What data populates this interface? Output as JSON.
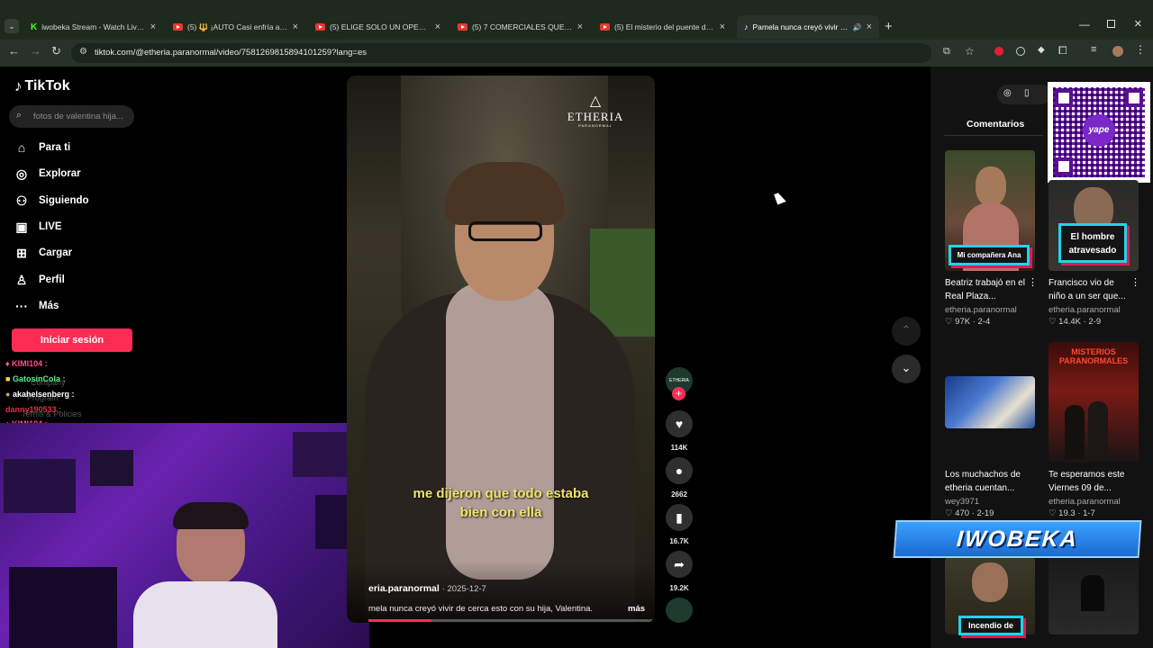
{
  "browser": {
    "tabs": [
      {
        "title": "iwobeka Stream - Watch Live o",
        "icon": "kick-icon"
      },
      {
        "title": "(5) 🔱 ¡AUTO Casi enfría a FEK",
        "icon": "youtube-icon"
      },
      {
        "title": "(5) ELIGE SOLO UN OPENING D",
        "icon": "youtube-icon"
      },
      {
        "title": "(5) 7 COMERCIALES QUE SE PR",
        "icon": "youtube-icon"
      },
      {
        "title": "(5) El misterio del puente dond",
        "icon": "youtube-icon"
      },
      {
        "title": "Pamela nunca creyó vivir de",
        "icon": "tiktok-icon"
      }
    ],
    "url": "tiktok.com/@etheria.paranormal/video/7581269815894101259?lang=es"
  },
  "tiktok": {
    "logo": "TikTok",
    "search_placeholder": "fotos de valentina hija...",
    "nav": [
      {
        "label": "Para ti",
        "icon": "home-icon"
      },
      {
        "label": "Explorar",
        "icon": "compass-icon"
      },
      {
        "label": "Siguiendo",
        "icon": "following-icon"
      },
      {
        "label": "LIVE",
        "icon": "live-icon"
      },
      {
        "label": "Cargar",
        "icon": "upload-icon"
      },
      {
        "label": "Perfil",
        "icon": "profile-icon"
      },
      {
        "label": "Más",
        "icon": "more-icon"
      }
    ],
    "login_label": "Iniciar sesión"
  },
  "video": {
    "brand": "ETHERIA",
    "brand_sub": "PARANORMAL",
    "subtitle_line1": "me dijeron que todo estaba",
    "subtitle_line2": "bien con ella",
    "author": "eria.paranormal",
    "date": "· 2025-12-7",
    "caption": "mela nunca creyó vivir de cerca esto con su hija, Valentina.",
    "more": "más",
    "likes": "114K",
    "comments": "2662",
    "saves": "16.7K",
    "shares": "19.2K"
  },
  "right_panel": {
    "tab_label": "Comentarios",
    "videos": [
      {
        "title": "Beatriz trabajó en el Real Plaza...",
        "user": "etheria.paranormal",
        "stats": "♡ 97K · 2-4",
        "tag": "Mi compañera Ana"
      },
      {
        "title": "Francisco vio de niño a un ser que...",
        "user": "etheria.paranormal",
        "stats": "♡ 14.4K · 2-9",
        "tag": "El hombre atravesado"
      },
      {
        "title": "Los muchachos de etheria cuentan...",
        "user": "wey3971",
        "stats": "♡ 470 · 2-19",
        "tag": ""
      },
      {
        "title": "Te esperamos este Viernes 09 de...",
        "user": "etheria.paranormal",
        "stats": "♡ 19.3 · 1-7",
        "tag": ""
      },
      {
        "title": "",
        "user": "",
        "stats": "",
        "tag": "Incendio de"
      }
    ]
  },
  "overlay": {
    "banner": "IWOBEKA",
    "chat": [
      {
        "user": "KIMI104 :",
        "color": "#ff4f86"
      },
      {
        "user": "GatosinCola :",
        "color": "#5ef08a"
      },
      {
        "user": "akahelsenberg :",
        "color": "#ffffff"
      },
      {
        "user": "danny190533 :",
        "color": "#e03040"
      },
      {
        "user": "KIMI104 :",
        "color": "#ff4f86"
      }
    ],
    "faint_company": "Company",
    "faint_program": "Program",
    "faint_terms": "Terms & Policies"
  },
  "qr": {
    "label": "yape"
  }
}
